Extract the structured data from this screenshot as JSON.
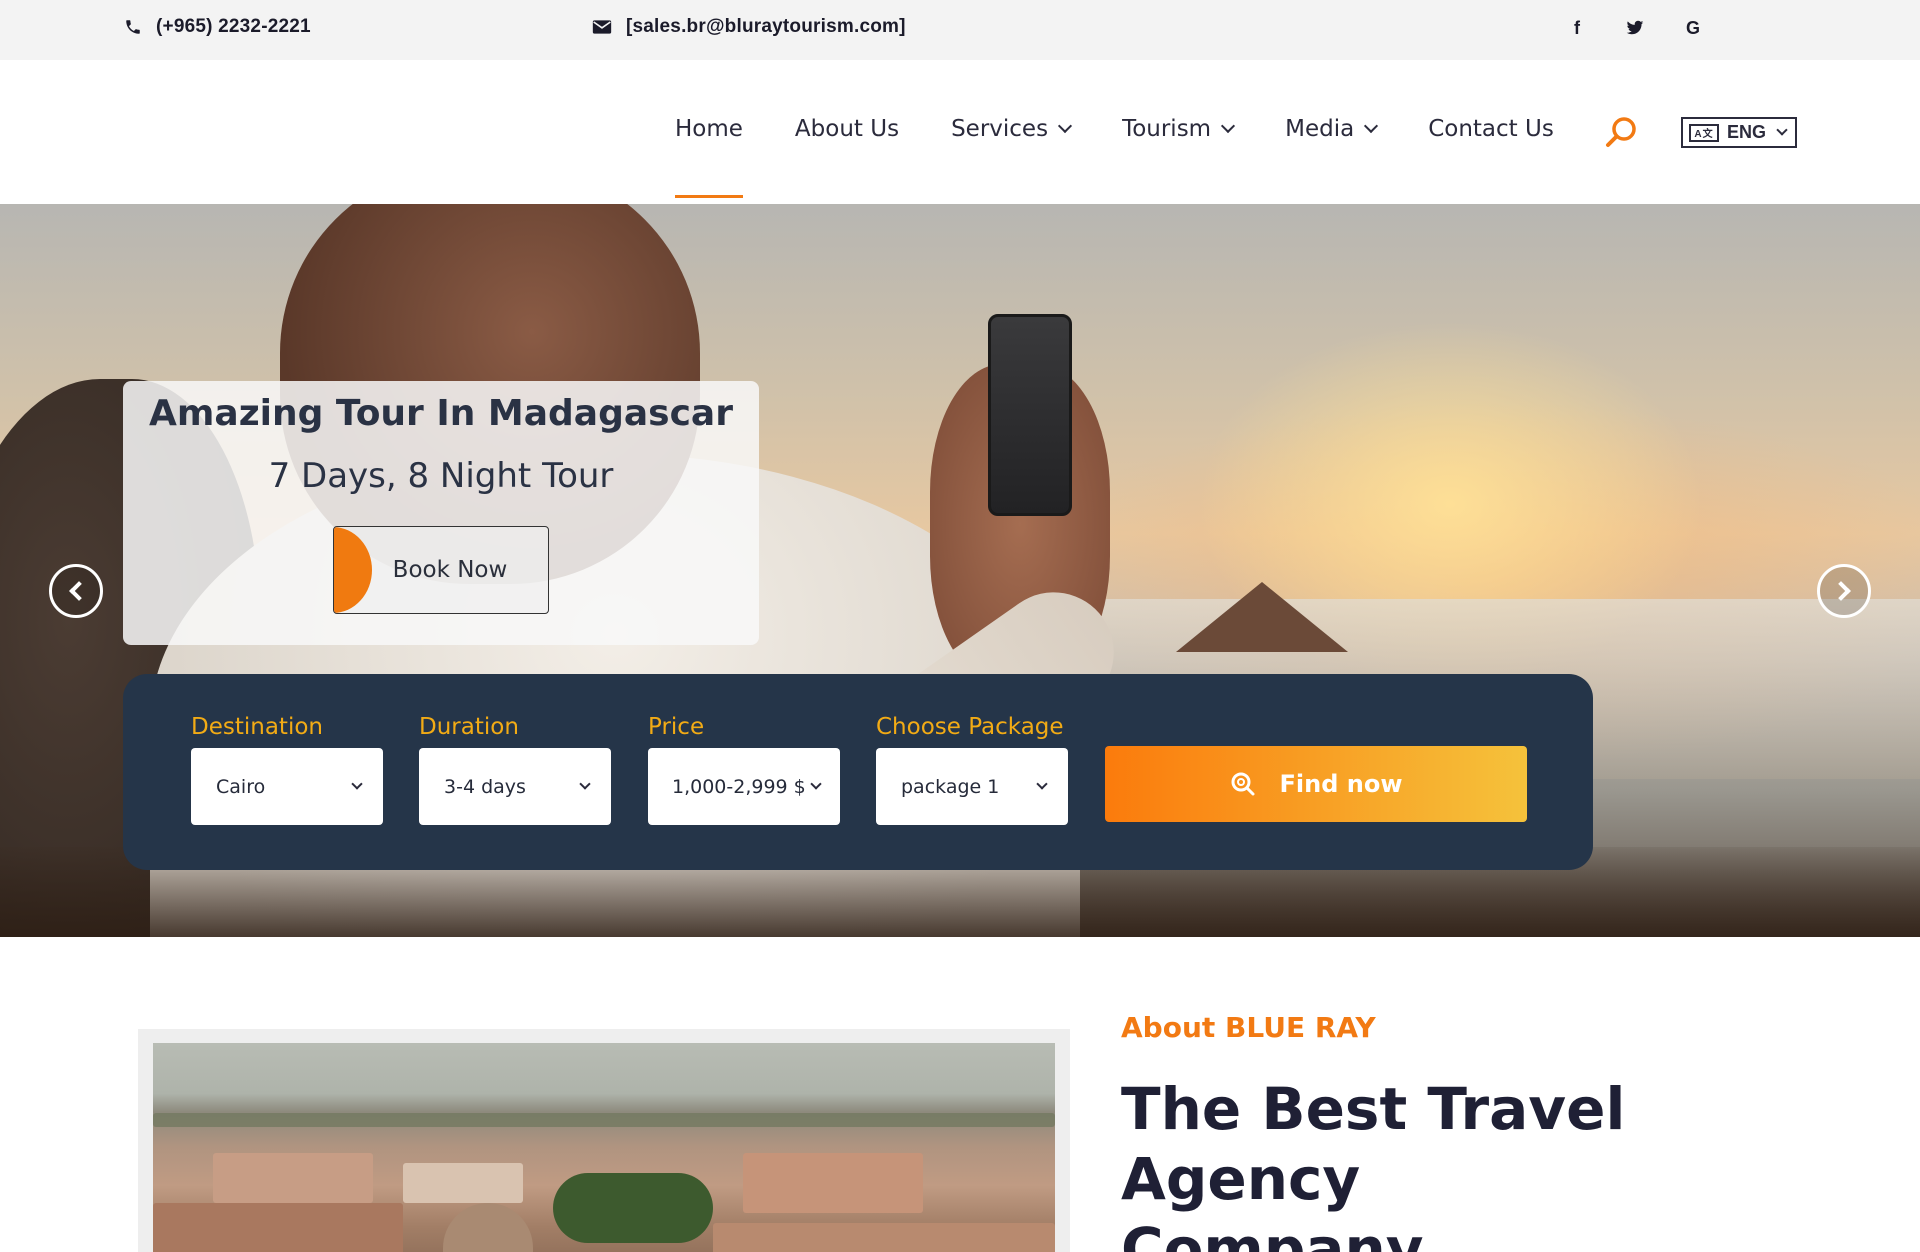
{
  "topbar": {
    "phone": "(+965) 2232-2221",
    "email": "[sales.br@bluraytourism.com]",
    "social": [
      {
        "icon": "facebook-icon",
        "glyph": "f"
      },
      {
        "icon": "twitter-icon",
        "glyph": "🐦"
      },
      {
        "icon": "google-icon",
        "glyph": "G"
      }
    ]
  },
  "nav": {
    "items": [
      {
        "label": "Home",
        "active": true,
        "dropdown": false
      },
      {
        "label": "About Us",
        "active": false,
        "dropdown": false
      },
      {
        "label": "Services",
        "active": false,
        "dropdown": true
      },
      {
        "label": "Tourism",
        "active": false,
        "dropdown": true
      },
      {
        "label": "Media",
        "active": false,
        "dropdown": true
      },
      {
        "label": "Contact Us",
        "active": false,
        "dropdown": false
      }
    ],
    "language": "ENG",
    "language_icon": "A文"
  },
  "hero": {
    "title": "Amazing Tour In Madagascar",
    "subtitle": "7 Days, 8 Night Tour",
    "cta": "Book Now",
    "search": {
      "fields": [
        {
          "label": "Destination",
          "value": "Cairo"
        },
        {
          "label": "Duration",
          "value": "3-4 days"
        },
        {
          "label": "Price",
          "value": "1,000-2,999 $"
        },
        {
          "label": "Choose Package",
          "value": "package 1"
        }
      ],
      "submit": "Find now"
    }
  },
  "about": {
    "kicker": "About BLUE RAY",
    "title": "The Best Travel Agency Company."
  },
  "colors": {
    "accent": "#f27a13",
    "panel": "#253549",
    "label": "#f2ab15"
  }
}
